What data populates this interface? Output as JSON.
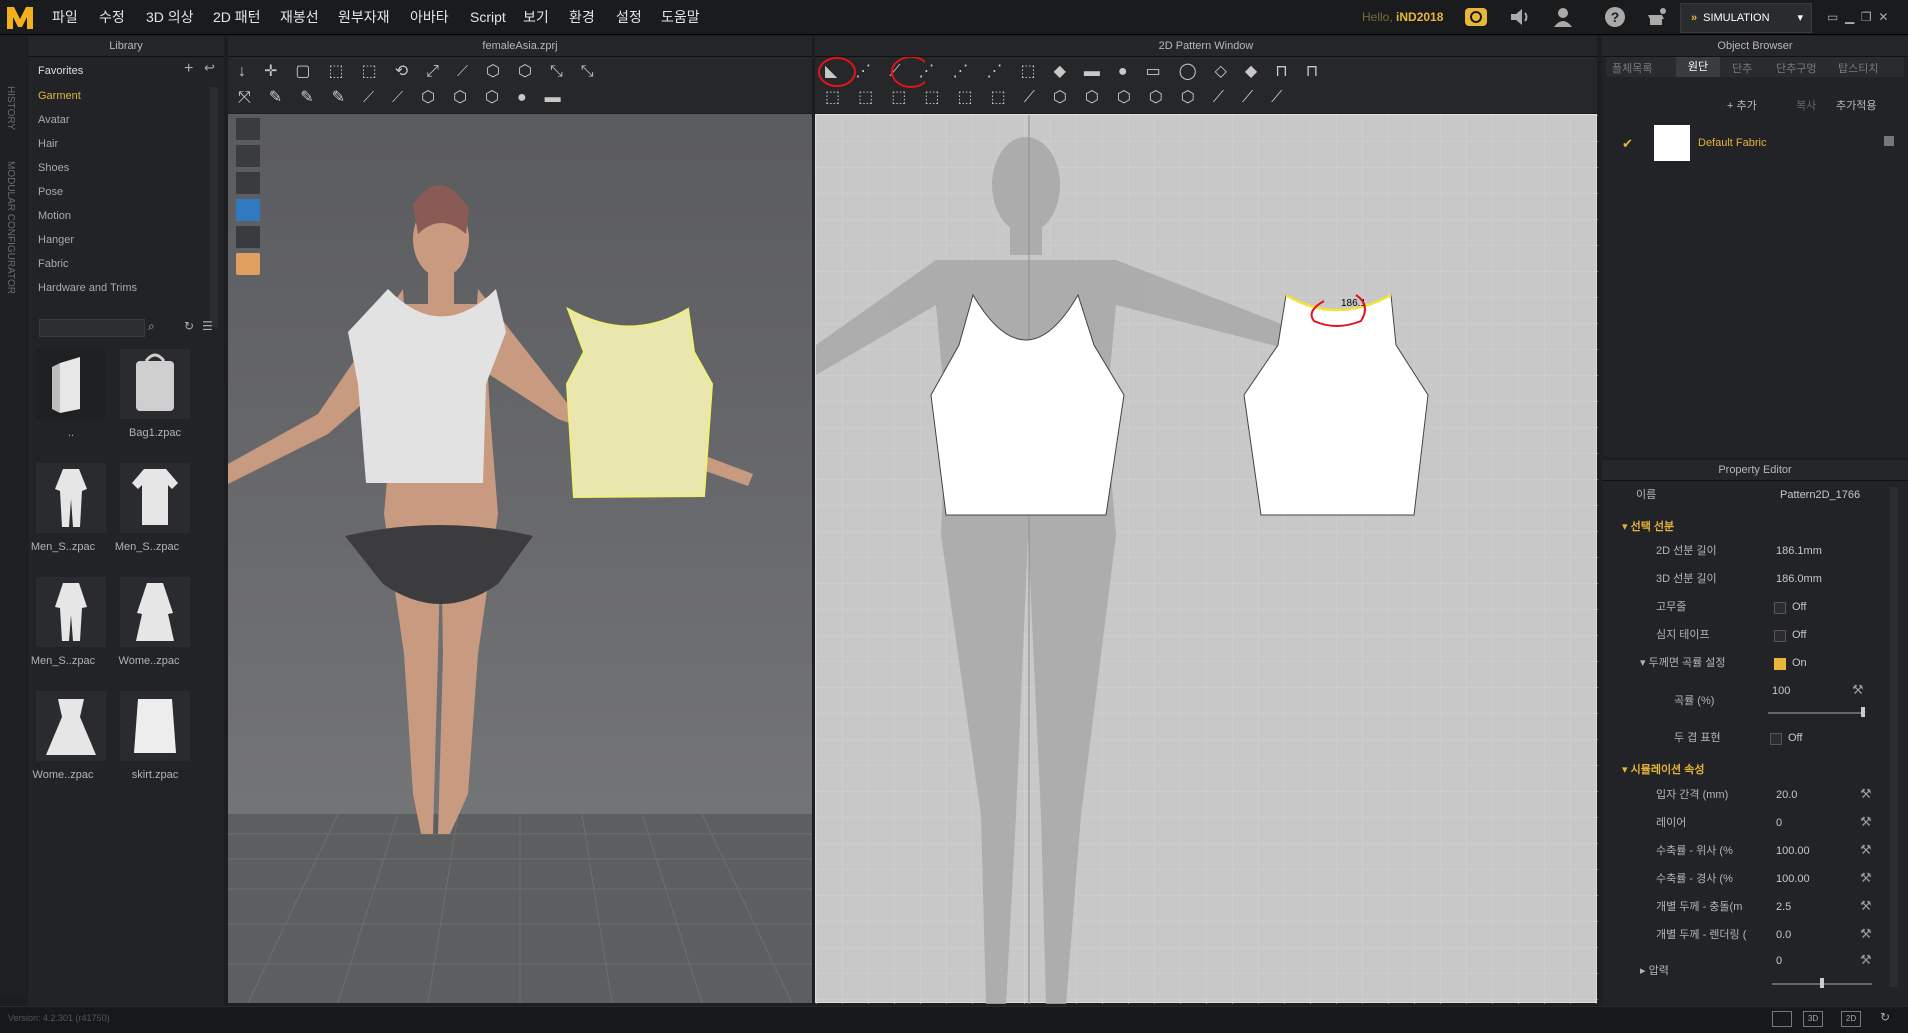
{
  "menu": [
    "파일",
    "수정",
    "3D 의상",
    "2D 패턴",
    "재봉선",
    "원부자재",
    "아바타",
    "Script",
    "보기",
    "환경",
    "설정",
    "도움말"
  ],
  "user": {
    "hello": "Hello,",
    "name": "iND2018"
  },
  "simulation_label": "SIMULATION",
  "library": {
    "title": "Library",
    "favorites": "Favorites",
    "categories": [
      "Garment",
      "Avatar",
      "Hair",
      "Shoes",
      "Pose",
      "Motion",
      "Hanger",
      "Fabric",
      "Hardware and Trims"
    ],
    "items": [
      {
        "label": ".."
      },
      {
        "label": "Bag1.zpac"
      },
      {
        "label": "Men_S..zpac"
      },
      {
        "label": "Men_S..zpac"
      },
      {
        "label": "Men_S..zpac"
      },
      {
        "label": "Wome..zpac"
      },
      {
        "label": "Wome..zpac"
      },
      {
        "label": "skirt.zpac"
      }
    ]
  },
  "side_tabs": {
    "history": "HISTORY",
    "modular": "MODULAR CONFIGURATOR"
  },
  "view3d": {
    "title": "femaleAsia.zprj"
  },
  "view2d": {
    "title": "2D Pattern Window",
    "measure": "186.1"
  },
  "object_browser": {
    "title": "Object Browser",
    "tabs": [
      "플체목록",
      "원단",
      "단추",
      "단추구멍",
      "탑스티치"
    ],
    "active_tab": "원단",
    "add": "+ 추가",
    "copy": "복사",
    "apply": "추가적용",
    "fabric": "Default Fabric"
  },
  "property_editor": {
    "title": "Property Editor",
    "name_label": "이름",
    "name_value": "Pattern2D_1766",
    "sec_line": "선택 선분",
    "rows": [
      {
        "label": "2D 선분 길이",
        "value": "186.1mm"
      },
      {
        "label": "3D 선분 길이",
        "value": "186.0mm"
      },
      {
        "label": "고무줄",
        "value": "Off"
      },
      {
        "label": "심지 테이프",
        "value": "Off"
      },
      {
        "label": "두께면 곡률 설정",
        "value": "On"
      },
      {
        "label": "곡률 (%)",
        "value": "100"
      },
      {
        "label": "두 겹 표현",
        "value": "Off"
      }
    ],
    "sec_sim": "시뮬레이션 속성",
    "sim_rows": [
      {
        "label": "입자 간격 (mm)",
        "value": "20.0"
      },
      {
        "label": "레이어",
        "value": "0"
      },
      {
        "label": "수축률 - 위사 (%",
        "value": "100.00"
      },
      {
        "label": "수축률 - 경사 (%",
        "value": "100.00"
      },
      {
        "label": "개별 두께 - 충돌(m",
        "value": "2.5"
      },
      {
        "label": "개별 두께 - 렌더링 (",
        "value": "0.0"
      },
      {
        "label": "압력",
        "value": "0"
      }
    ]
  },
  "version": "Version: 4.2.301 (r41750)",
  "colors": {
    "accent": "#e8b73a",
    "red": "#e0141a"
  }
}
